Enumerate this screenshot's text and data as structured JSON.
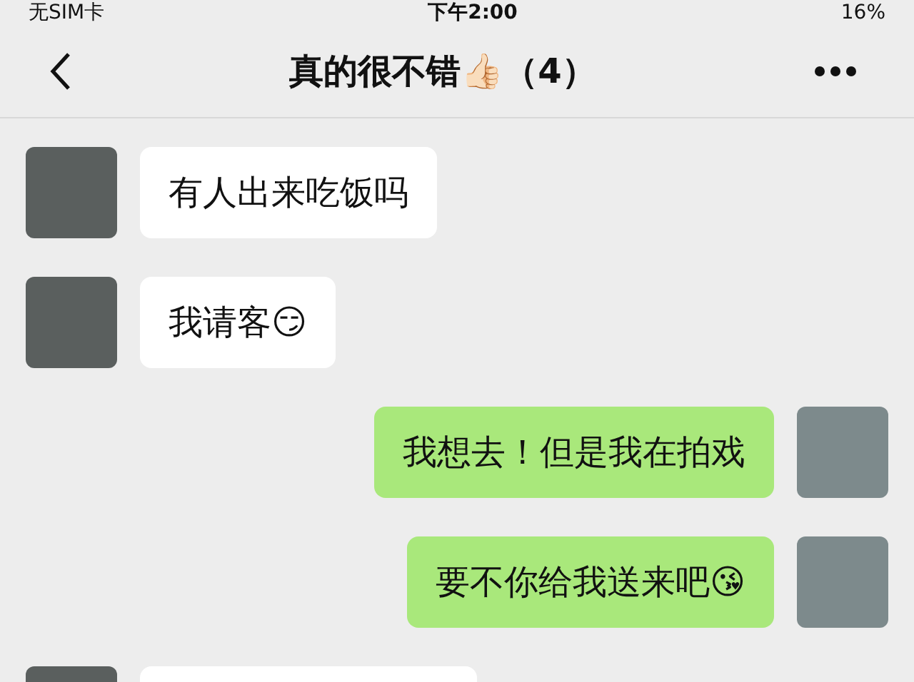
{
  "status_bar": {
    "carrier": "无SIM卡",
    "time": "下午2:00",
    "battery": "16%"
  },
  "nav": {
    "title": "真的很不错👍🏻（4）"
  },
  "messages": [
    {
      "kind": "incoming",
      "text": "有人出来吃饭吗"
    },
    {
      "kind": "incoming",
      "text": "我请客😏"
    },
    {
      "kind": "outgoing",
      "text": "我想去！但是我在拍戏"
    },
    {
      "kind": "outgoing",
      "text": "要不你给我送来吧😘"
    },
    {
      "kind": "incoming"
    }
  ]
}
